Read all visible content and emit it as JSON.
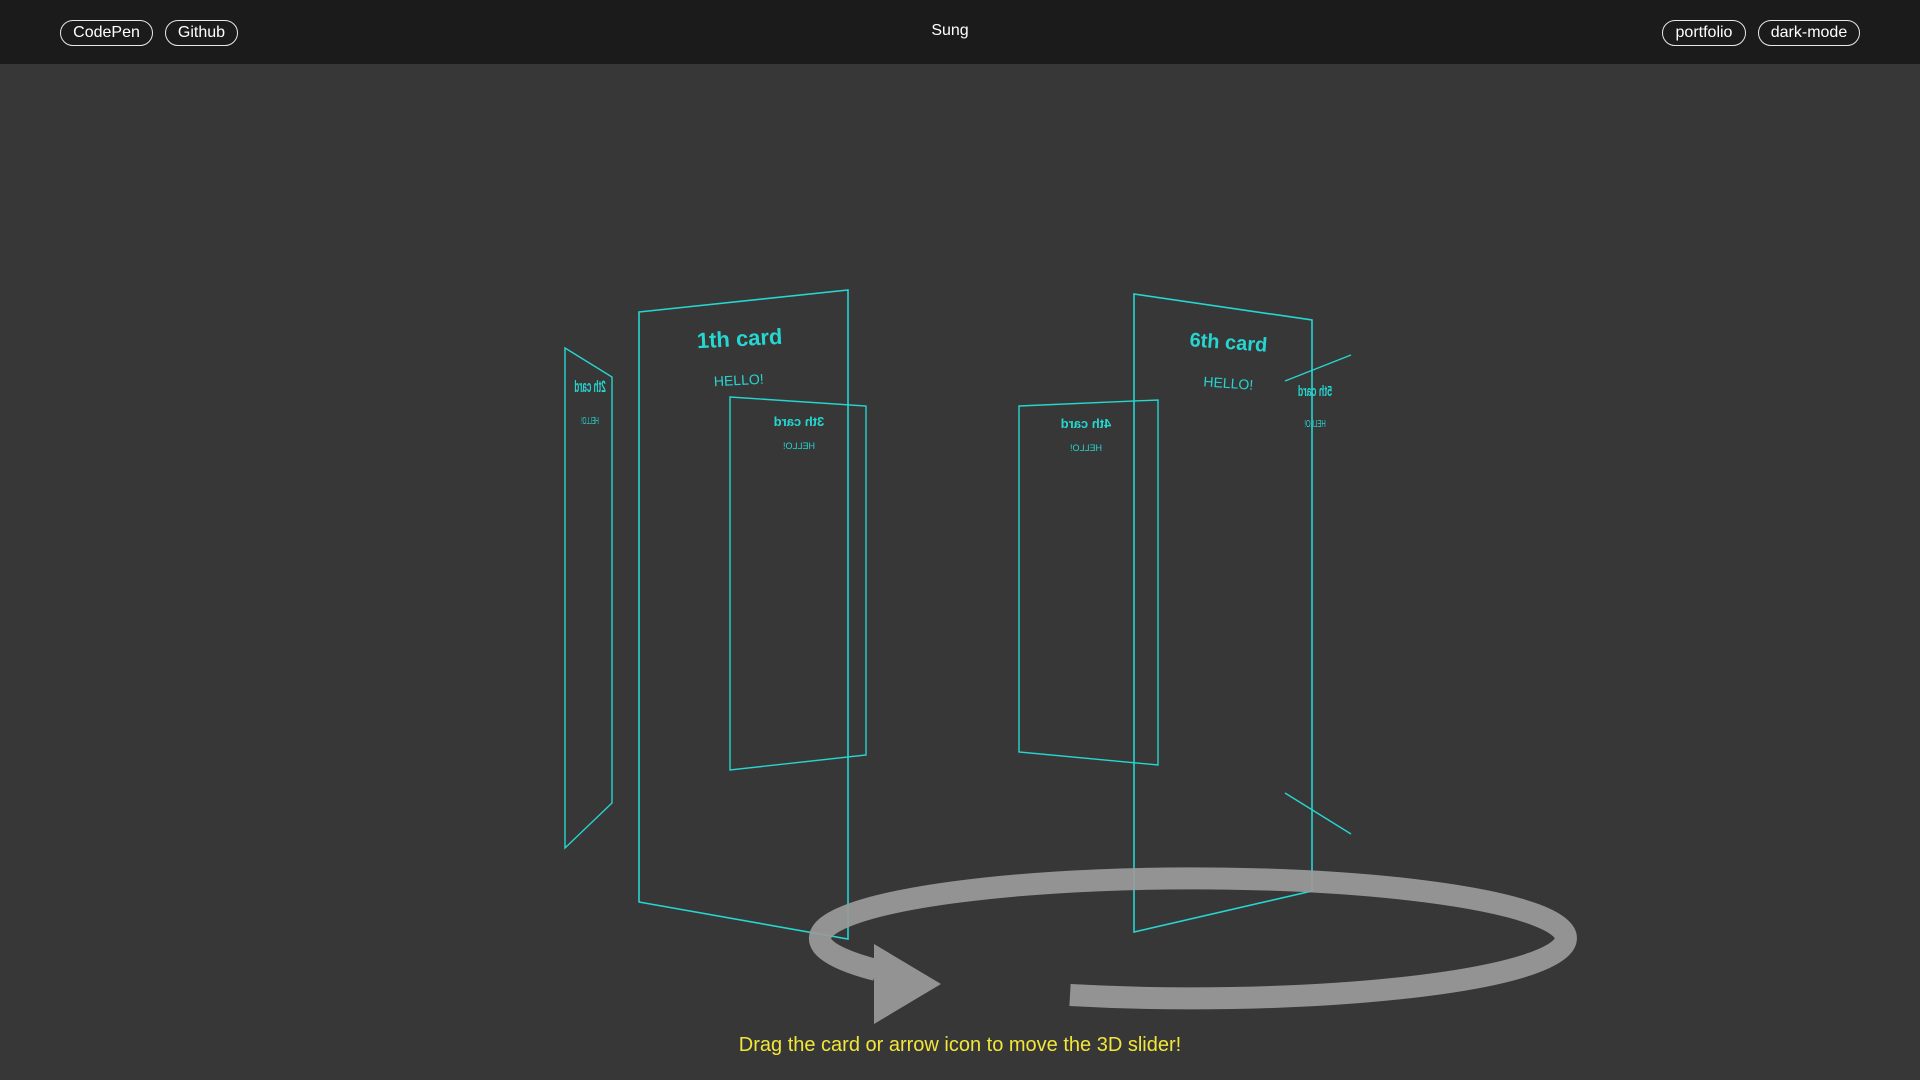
{
  "header": {
    "brand": "Sung",
    "left_links": [
      "CodePen",
      "Github"
    ],
    "right_links": [
      "portfolio",
      "dark-mode"
    ]
  },
  "cards": [
    {
      "title": "1th card",
      "text": "HELLO!"
    },
    {
      "title": "6th card",
      "text": "HELLO!"
    },
    {
      "title": "3th card",
      "text": "HELLO!"
    },
    {
      "title": "4th card",
      "text": "HELLO!"
    },
    {
      "title": "2th card",
      "text": "HELLO!"
    },
    {
      "title": "5th card",
      "text": "HELLO!"
    }
  ],
  "hint": "Drag the card or arrow icon to move the 3D slider!",
  "colors": {
    "card_outline": "#26d6d0",
    "hint_text": "#f2e63a",
    "arrow": "#9b9b9b",
    "background": "#373737",
    "header_bg": "#1b1b1b"
  },
  "icons": {
    "rotate_arrow": "circular-arrow-icon"
  }
}
